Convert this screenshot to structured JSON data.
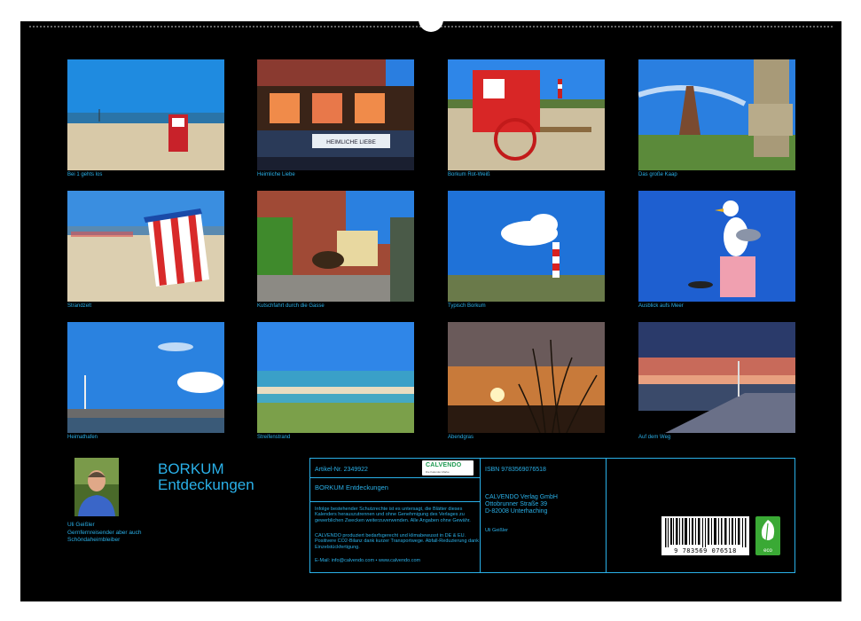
{
  "photos": [
    {
      "caption": "Bei 1 gehts los"
    },
    {
      "caption": "Heimliche Liebe"
    },
    {
      "caption": "Borkum Rot-Weiß"
    },
    {
      "caption": "Das große Kaap"
    },
    {
      "caption": "Strandzelt"
    },
    {
      "caption": "Kutschfahrt durch die Gasse"
    },
    {
      "caption": "Typisch Borkum"
    },
    {
      "caption": "Ausblick aufs Meer"
    },
    {
      "caption": "Heimathafen"
    },
    {
      "caption": "Streifenstrand"
    },
    {
      "caption": "Abendgras"
    },
    {
      "caption": "Auf dem Weg"
    }
  ],
  "sign_text": "HEIMLICHE LIEBE",
  "title_line1": "BORKUM",
  "title_line2": "Entdeckungen",
  "author": {
    "name": "Uli Geißler",
    "desc": "Gernfernreisender aber auch Schöndaheimbleiber"
  },
  "info": {
    "article": "Artikel-Nr. 2349922",
    "calvendo_logo": "CALVENDO",
    "calvendo_sub": "Die Kalender-Marke",
    "product_title": "BORKUM Entdeckungen",
    "legal": "Infolge bestehender Schutzrechte ist es untersagt, die Blätter dieses Kalenders herauszutrennen und ohne Genehmigung des Verlages zu gewerblichen Zwecken weiterzuverwenden. Alle Angaben ohne Gewähr.",
    "eco_text": "CALVENDO produziert bedarfsgerecht und klimabewusst in DE & EU. Positivere CO2-Bilanz dank kurzer Transportwege. Abfall-Reduzierung dank Einzelstückfertigung.",
    "contact": "E-Mail: info@calvendo.com • www.calvendo.com",
    "isbn": "ISBN 9783569076518",
    "publisher_name": "CALVENDO Verlag GmbH",
    "publisher_street": "Ottobrunner Straße 39",
    "publisher_city": "D-82008 Unterhaching",
    "author_credit": "Uli Geißler",
    "barcode_number": "9 783569 076518",
    "eco_label": "eco"
  }
}
